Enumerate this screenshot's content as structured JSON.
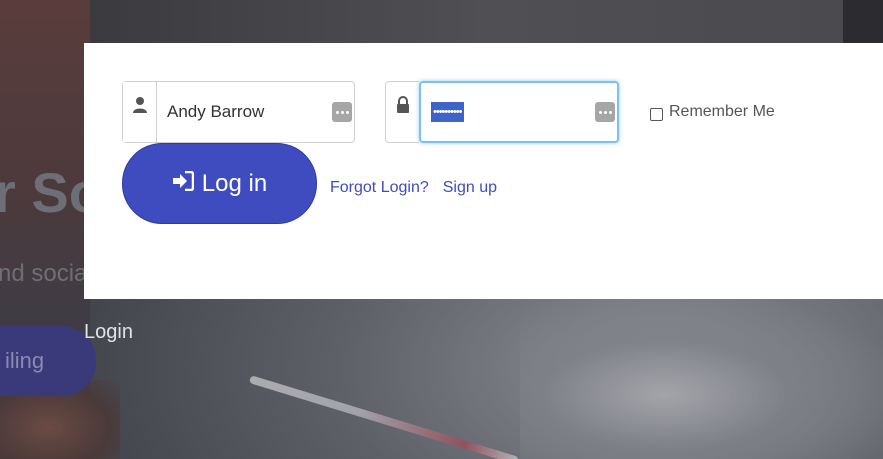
{
  "background": {
    "hero_title_partial": "r So",
    "hero_subtitle_partial": "nd socia",
    "hero_button_partial": "iling",
    "login_link": "Login"
  },
  "login_form": {
    "username_value": "Andy Barrow",
    "password_value": "••••••••••",
    "remember_label": "Remember Me",
    "remember_checked": false,
    "login_button_label": "Log in",
    "forgot_link": "Forgot Login?",
    "signup_link": "Sign up"
  },
  "icons": {
    "user": "user-icon",
    "lock": "lock-icon",
    "signin": "sign-in-icon",
    "autofill": "autofill-icon"
  },
  "colors": {
    "primary": "#3f4cc0",
    "focus": "#7cc0ef",
    "overlay": "#44464c"
  }
}
